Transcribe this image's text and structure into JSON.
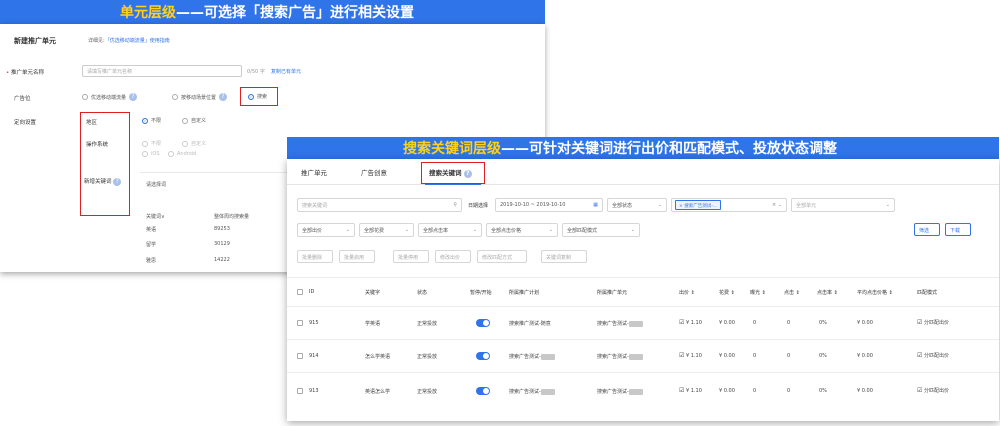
{
  "banner1": {
    "prefix": "单元层级",
    "text": "——可选择「搜索广告」进行相关设置"
  },
  "panel1": {
    "title": "新建推广单元",
    "note_prefix": "详细见:",
    "note_link": "「优选移动端流量」使用指南",
    "name_label": "推广单元名称",
    "name_placeholder": "请填写推广单元名称",
    "name_count": "0/50 字",
    "copy_link": "复制已有单元",
    "ad_position_label": "广告位",
    "ad_positions": [
      "优选移动端流量",
      "按移动场景位置",
      "搜索"
    ],
    "targeting_label": "定向设置",
    "region_label": "地区",
    "region_options": [
      "不限",
      "自定义"
    ],
    "os_label": "操作系统",
    "os_options": [
      "不限",
      "自定义"
    ],
    "os_sub_options": [
      "iOS",
      "Android"
    ],
    "keyword_label": "新增关键词",
    "keyword_search": "请选择词",
    "kw_col1": "关键词",
    "kw_col2": "整体周均搜索量",
    "kw_rows": [
      {
        "word": "英语",
        "vol": "89253"
      },
      {
        "word": "留学",
        "vol": "30129"
      },
      {
        "word": "雅思",
        "vol": "14222"
      }
    ]
  },
  "banner2": {
    "prefix": "搜索关键词层级",
    "text": "——可针对关键词进行出价和匹配模式、投放状态调整"
  },
  "panel2": {
    "tabs": [
      "推广单元",
      "广告创意",
      "搜索关键词"
    ],
    "search_placeholder": "搜索关键词",
    "date_label": "日期选择",
    "date_value": "2019-10-10 ~ 2019-10-10",
    "status_select": "全部状态",
    "plan_tag": "搜索广告测试-...",
    "unit_select": "全部单元",
    "filters": [
      "全部出价",
      "全部花费",
      "全部点击率",
      "全部点击价格",
      "全部匹配模式"
    ],
    "filter_btn": "筛选",
    "download_btn": "下载",
    "actions": [
      "批量删除",
      "批量启用",
      "批量停用",
      "修改出价",
      "修改匹配方式",
      "关键词复制"
    ],
    "headers": [
      "ID",
      "关键字",
      "状态",
      "暂停/开始",
      "所属推广计划",
      "所属推广单元",
      "出价",
      "花费",
      "曝光",
      "点击",
      "点击率",
      "平均点击价格",
      "匹配模式"
    ],
    "rows": [
      {
        "id": "915",
        "kw": "学英语",
        "status": "正常投放",
        "plan": "搜索推广测试-随意",
        "unit": "搜索广告测试-",
        "bid": "¥ 1.10",
        "cost": "¥ 0.00",
        "imp": "0",
        "click": "0",
        "ctr": "0%",
        "cpc": "¥ 0.00",
        "match": "分匹配出价"
      },
      {
        "id": "914",
        "kw": "怎么学英语",
        "status": "正常投放",
        "plan": "搜索广告测试-",
        "unit": "搜索广告测试-",
        "bid": "¥ 1.10",
        "cost": "¥ 0.00",
        "imp": "0",
        "click": "0",
        "ctr": "0%",
        "cpc": "¥ 0.00",
        "match": "分匹配出价"
      },
      {
        "id": "913",
        "kw": "英语怎么学",
        "status": "正常投放",
        "plan": "搜索广告测试-",
        "unit": "搜索广告测试-",
        "bid": "¥ 1.10",
        "cost": "¥ 0.00",
        "imp": "0",
        "click": "0",
        "ctr": "0%",
        "cpc": "¥ 0.00",
        "match": "分匹配出价"
      }
    ]
  },
  "colors": {
    "banner": "#2f74e8",
    "highlight": "#ffd21a",
    "redbox": "#e02020",
    "accent": "#2f74e8"
  }
}
